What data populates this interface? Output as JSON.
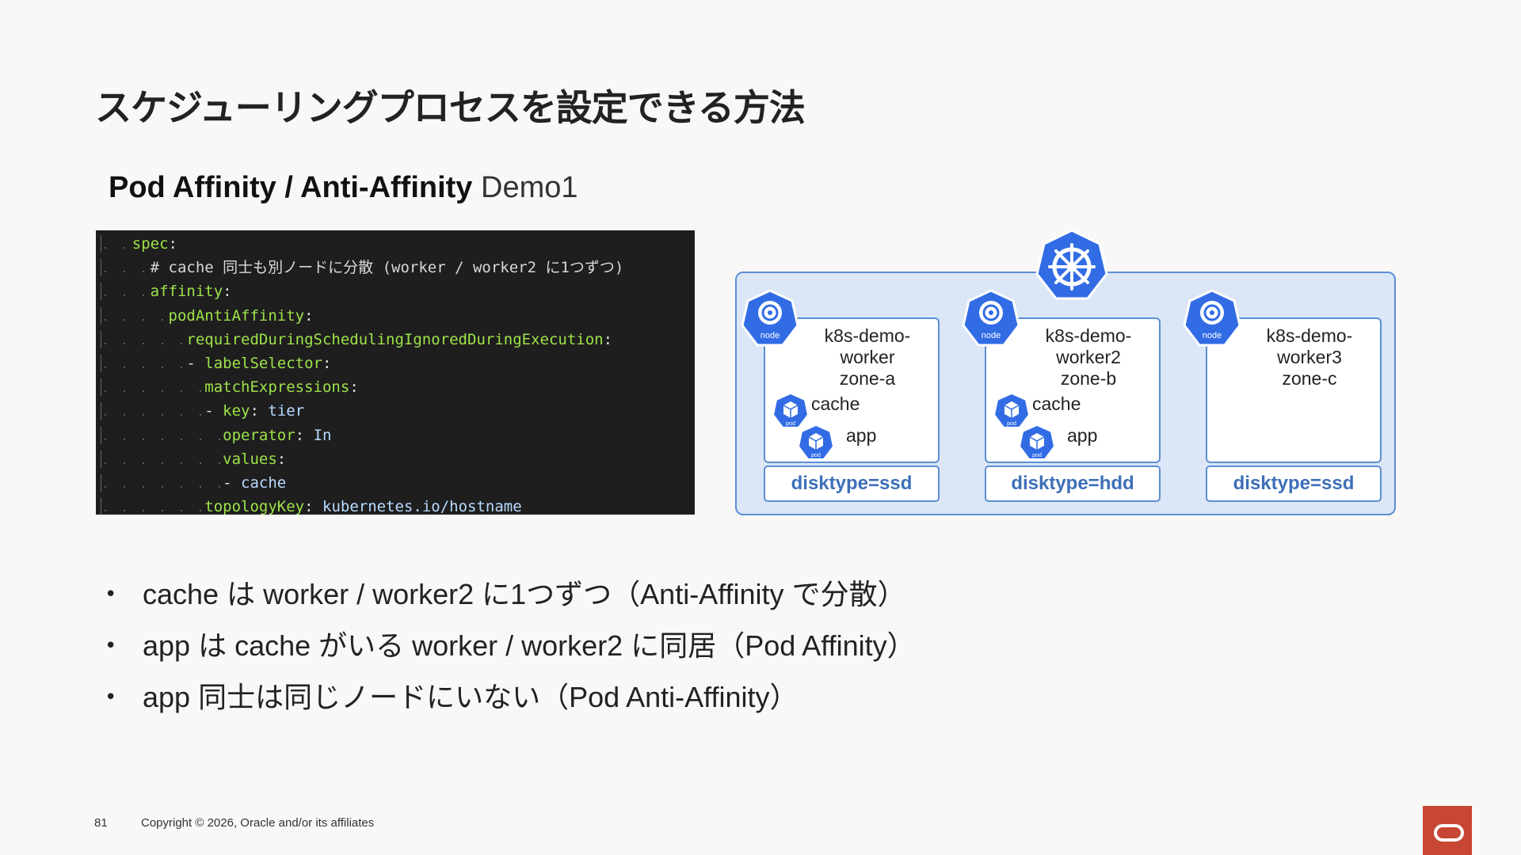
{
  "title": "スケジューリングプロセスを設定できる方法",
  "subtitle": {
    "main": "Pod Affinity / Anti-Affinity ",
    "suffix": "Demo1"
  },
  "code": [
    {
      "indent": 2,
      "parts": [
        {
          "t": "spec",
          "c": "c-key"
        },
        {
          "t": ":",
          "c": "c-punct"
        }
      ]
    },
    {
      "indent": 3,
      "parts": [
        {
          "t": "# cache 同士も別ノードに分散 (worker / worker2 に1つずつ)",
          "c": "c-comment"
        }
      ]
    },
    {
      "indent": 3,
      "parts": [
        {
          "t": "affinity",
          "c": "c-key"
        },
        {
          "t": ":",
          "c": "c-punct"
        }
      ]
    },
    {
      "indent": 4,
      "parts": [
        {
          "t": "podAntiAffinity",
          "c": "c-key"
        },
        {
          "t": ":",
          "c": "c-punct"
        }
      ]
    },
    {
      "indent": 5,
      "parts": [
        {
          "t": "requiredDuringSchedulingIgnoredDuringExecution",
          "c": "c-key"
        },
        {
          "t": ":",
          "c": "c-punct"
        }
      ]
    },
    {
      "indent": 5,
      "parts": [
        {
          "t": "- ",
          "c": "c-dash"
        },
        {
          "t": "labelSelector",
          "c": "c-key"
        },
        {
          "t": ":",
          "c": "c-punct"
        }
      ]
    },
    {
      "indent": 6,
      "parts": [
        {
          "t": "matchExpressions",
          "c": "c-key"
        },
        {
          "t": ":",
          "c": "c-punct"
        }
      ]
    },
    {
      "indent": 6,
      "parts": [
        {
          "t": "- ",
          "c": "c-dash"
        },
        {
          "t": "key",
          "c": "c-key"
        },
        {
          "t": ": ",
          "c": "c-punct"
        },
        {
          "t": "tier",
          "c": "c-val"
        }
      ]
    },
    {
      "indent": 7,
      "parts": [
        {
          "t": "operator",
          "c": "c-key"
        },
        {
          "t": ": ",
          "c": "c-punct"
        },
        {
          "t": "In",
          "c": "c-val"
        }
      ]
    },
    {
      "indent": 7,
      "parts": [
        {
          "t": "values",
          "c": "c-key"
        },
        {
          "t": ":",
          "c": "c-punct"
        }
      ]
    },
    {
      "indent": 7,
      "parts": [
        {
          "t": "- ",
          "c": "c-dash"
        },
        {
          "t": "cache",
          "c": "c-val"
        }
      ]
    },
    {
      "indent": 6,
      "parts": [
        {
          "t": "topologyKey",
          "c": "c-key"
        },
        {
          "t": ": ",
          "c": "c-punct"
        },
        {
          "t": "kubernetes.io/hostname",
          "c": "c-val"
        }
      ]
    }
  ],
  "diagram": {
    "control_plane_icon": "kubernetes-helm-icon",
    "node_badge": "node",
    "pod_badge": "pod",
    "nodes": [
      {
        "name_lines": [
          "k8s-demo-",
          "worker",
          "zone-a"
        ],
        "pods": [
          "cache",
          "app"
        ],
        "disktype": "disktype=ssd"
      },
      {
        "name_lines": [
          "k8s-demo-",
          "worker2",
          "zone-b"
        ],
        "pods": [
          "cache",
          "app"
        ],
        "disktype": "disktype=hdd"
      },
      {
        "name_lines": [
          "k8s-demo-",
          "worker3",
          "zone-c"
        ],
        "pods": [],
        "disktype": "disktype=ssd"
      }
    ]
  },
  "bullets": [
    "cache は worker / worker2 に1つずつ（Anti-Affinity で分散）",
    "app は cache がいる worker / worker2 に同居（Pod Affinity）",
    "app 同士は同じノードにいない（Pod Anti-Affinity）"
  ],
  "footer": {
    "page_number": "81",
    "copyright": "Copyright © 2026, Oracle and/or its affiliates"
  },
  "colors": {
    "k8s_blue": "#326ce5",
    "panel_border": "#5b8fd4",
    "panel_fill": "#dbe6f6",
    "oracle_red": "#c74634"
  }
}
